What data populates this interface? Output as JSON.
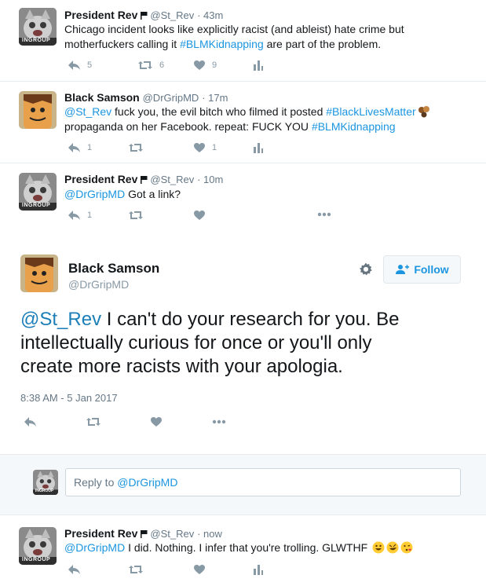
{
  "tweets": [
    {
      "name": "President Rev",
      "handle": "@St_Rev",
      "time": "· 43m",
      "text_before": "Chicago incident looks like explicitly racist (and ableist) hate crime but motherfuckers calling it ",
      "hashtag": "#BLMKidnapping",
      "text_after": " are part of the problem.",
      "reply_count": "5",
      "retweet_count": "6",
      "like_count": "9",
      "avatar_caption": "INGROUP"
    },
    {
      "name": "Black Samson",
      "handle": "@DrGripMD",
      "time": "· 17m",
      "mention": "@St_Rev",
      "text_mid": " fuck you, the evil bitch who filmed it posted ",
      "hashtag1": "#BlackLivesMatter",
      "text_line2": "propaganda on her Facebook. repeat: FUCK YOU ",
      "hashtag2": "#BLMKidnapping",
      "reply_count": "1",
      "like_count": "1"
    },
    {
      "name": "President Rev",
      "handle": "@St_Rev",
      "time": "· 10m",
      "mention": "@DrGripMD",
      "text": " Got a link?",
      "reply_count": "1",
      "avatar_caption": "INGROUP"
    }
  ],
  "main": {
    "name": "Black Samson",
    "handle": "@DrGripMD",
    "follow_label": "Follow",
    "mention": "@St_Rev",
    "text_line1": " I can't do your research for you. Be",
    "text_line2": "intellectually curious for once or you'll only",
    "text_line3": "create more racists with your apologia.",
    "timestamp": "8:38 AM - 5 Jan 2017"
  },
  "reply": {
    "placeholder_prefix": "Reply to ",
    "placeholder_mention": "@DrGripMD",
    "avatar_caption": "INGROUP"
  },
  "last_tweet": {
    "name": "President Rev",
    "handle": "@St_Rev",
    "time": "· now",
    "mention": "@DrGripMD",
    "text": " I did. Nothing. I infer that you're trolling. GLWTHF",
    "avatar_caption": "INGROUP"
  },
  "icons": {
    "reply": "reply-icon",
    "retweet": "retweet-icon",
    "like": "heart-icon",
    "analytics": "analytics-icon",
    "more": "more-icon",
    "settings": "gear-icon",
    "follow": "add-user-icon",
    "flag": "flag-icon"
  },
  "colors": {
    "link": "#1b95e0",
    "icon_gray": "#8899a6",
    "border": "#e6ecf0"
  }
}
